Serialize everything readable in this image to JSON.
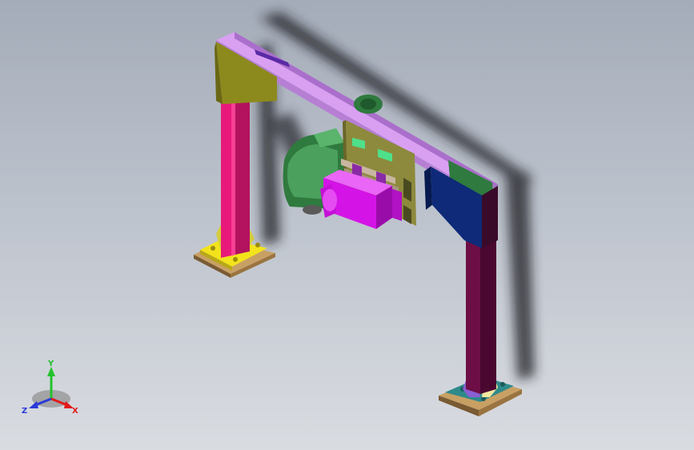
{
  "viewport": {
    "background_top": "#a4acb9",
    "background_bottom": "#d9dce1"
  },
  "model": {
    "parts": [
      {
        "id": "top-beam",
        "color": "#d9a0f2"
      },
      {
        "id": "left-gusset-block",
        "color": "#8c8a1c"
      },
      {
        "id": "left-column",
        "color": "#e8197a"
      },
      {
        "id": "right-column",
        "color": "#6e0e46"
      },
      {
        "id": "right-gusset-block",
        "color": "#0e2a78"
      },
      {
        "id": "motor-housing",
        "color": "#2f7a3e"
      },
      {
        "id": "gearbox",
        "color": "#d414e6"
      },
      {
        "id": "mount-plate",
        "color": "#8d8a3d"
      },
      {
        "id": "green-clamps",
        "color": "#4fe08a"
      },
      {
        "id": "base-plates",
        "color": "#c8a064"
      },
      {
        "id": "left-base-pads",
        "color": "#f2e31c"
      },
      {
        "id": "right-base-pads",
        "color": "#2f8a8a"
      }
    ]
  },
  "triad": {
    "x_label": "X",
    "y_label": "Y",
    "z_label": "Z",
    "x_color": "#e21a1a",
    "y_color": "#22c22a",
    "z_color": "#2a3ad9"
  }
}
